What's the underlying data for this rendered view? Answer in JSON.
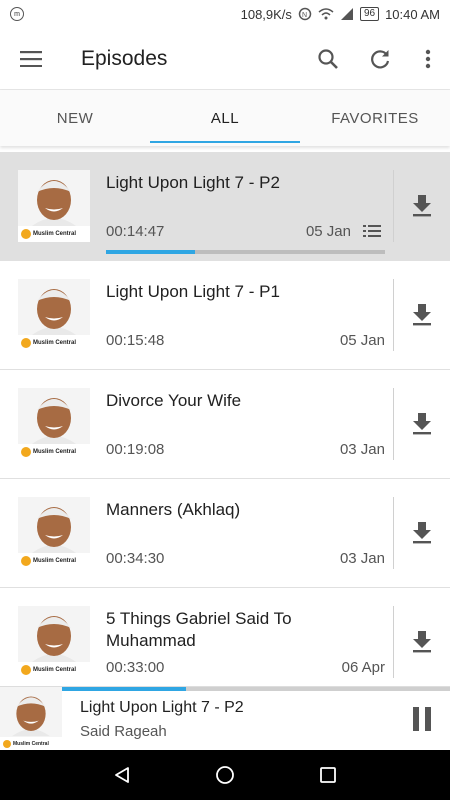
{
  "status_bar": {
    "speed": "108,9K/s",
    "battery": "96",
    "time": "10:40 AM"
  },
  "appbar": {
    "title": "Episodes",
    "icons": [
      "menu-icon",
      "search-icon",
      "refresh-icon",
      "more-vert-icon"
    ]
  },
  "tabs": [
    {
      "label": "NEW",
      "active": false
    },
    {
      "label": "ALL",
      "active": true
    },
    {
      "label": "FAVORITES",
      "active": false
    }
  ],
  "episodes": [
    {
      "title": "Light Upon Light 7 - P2",
      "duration": "00:14:47",
      "date": "05 Jan",
      "selected": true,
      "progress": 0.32,
      "queued": true
    },
    {
      "title": "Light Upon Light 7 - P1",
      "duration": "00:15:48",
      "date": "05 Jan",
      "selected": false
    },
    {
      "title": "Divorce Your Wife",
      "duration": "00:19:08",
      "date": "03 Jan",
      "selected": false
    },
    {
      "title": "Manners (Akhlaq)",
      "duration": "00:34:30",
      "date": "03 Jan",
      "selected": false
    },
    {
      "title": "5 Things Gabriel Said To Muhammad",
      "duration": "00:33:00",
      "date": "06 Apr",
      "selected": false
    }
  ],
  "thumbnail_logo": "Muslim Central",
  "player": {
    "title": "Light Upon Light 7 - P2",
    "subtitle": "Said Rageah",
    "progress": 0.32
  },
  "colors": {
    "accent": "#2fa6e3",
    "logo": "#f2a81d"
  }
}
